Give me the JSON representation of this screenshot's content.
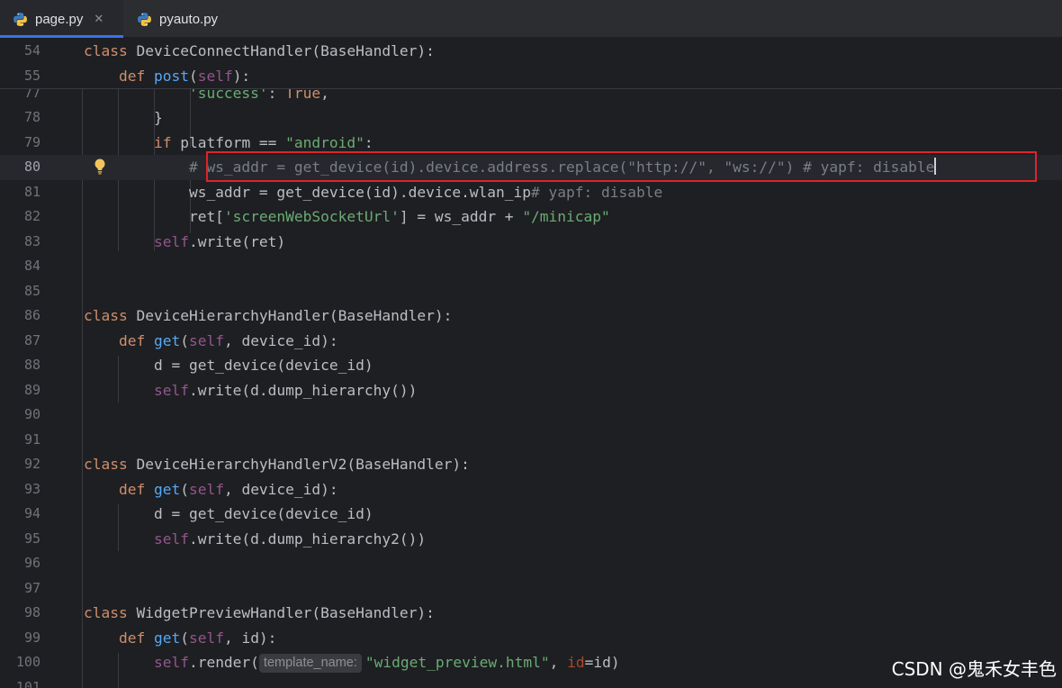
{
  "tabs": [
    {
      "label": "page.py",
      "active": true,
      "closable": true
    },
    {
      "label": "pyauto.py",
      "active": false,
      "closable": false
    }
  ],
  "sticky_lines": [
    {
      "number": "54",
      "text": "class DeviceConnectHandler(BaseHandler):"
    },
    {
      "number": "55",
      "text": "    def post(self):"
    }
  ],
  "lines": [
    {
      "number": "77",
      "text": "            'success': True,"
    },
    {
      "number": "78",
      "text": "        }"
    },
    {
      "number": "79",
      "text": "        if platform == \"android\":"
    },
    {
      "number": "80",
      "text": "            # ws_addr = get_device(id).device.address.replace(\"http://\", \"ws://\") # yapf: disable"
    },
    {
      "number": "81",
      "text": "            ws_addr = get_device(id).device.wlan_ip# yapf: disable"
    },
    {
      "number": "82",
      "text": "            ret['screenWebSocketUrl'] = ws_addr + \"/minicap\""
    },
    {
      "number": "83",
      "text": "        self.write(ret)"
    },
    {
      "number": "84",
      "text": ""
    },
    {
      "number": "85",
      "text": ""
    },
    {
      "number": "86",
      "text": "class DeviceHierarchyHandler(BaseHandler):"
    },
    {
      "number": "87",
      "text": "    def get(self, device_id):"
    },
    {
      "number": "88",
      "text": "        d = get_device(device_id)"
    },
    {
      "number": "89",
      "text": "        self.write(d.dump_hierarchy())"
    },
    {
      "number": "90",
      "text": ""
    },
    {
      "number": "91",
      "text": ""
    },
    {
      "number": "92",
      "text": "class DeviceHierarchyHandlerV2(BaseHandler):"
    },
    {
      "number": "93",
      "text": "    def get(self, device_id):"
    },
    {
      "number": "94",
      "text": "        d = get_device(device_id)"
    },
    {
      "number": "95",
      "text": "        self.write(d.dump_hierarchy2())"
    },
    {
      "number": "96",
      "text": ""
    },
    {
      "number": "97",
      "text": ""
    },
    {
      "number": "98",
      "text": "class WidgetPreviewHandler(BaseHandler):"
    },
    {
      "number": "99",
      "text": "    def get(self, id):"
    },
    {
      "number": "100",
      "text": "        self.render(template_name: \"widget_preview.html\", id=id)"
    },
    {
      "number": "101",
      "text": ""
    }
  ],
  "current_line": "80",
  "inlay_hint": "template_name:",
  "watermark": "CSDN @鬼禾女丰色",
  "colors": {
    "background": "#1e1f22",
    "keyword": "#cf8e6d",
    "function": "#56a8f5",
    "self": "#94558d",
    "string": "#6aab73",
    "comment": "#7a7e85",
    "highlight_box": "#e1232a",
    "tab_accent": "#3574f0"
  },
  "icons": {
    "file_tab": "python-icon",
    "gutter": "lightbulb-icon"
  }
}
